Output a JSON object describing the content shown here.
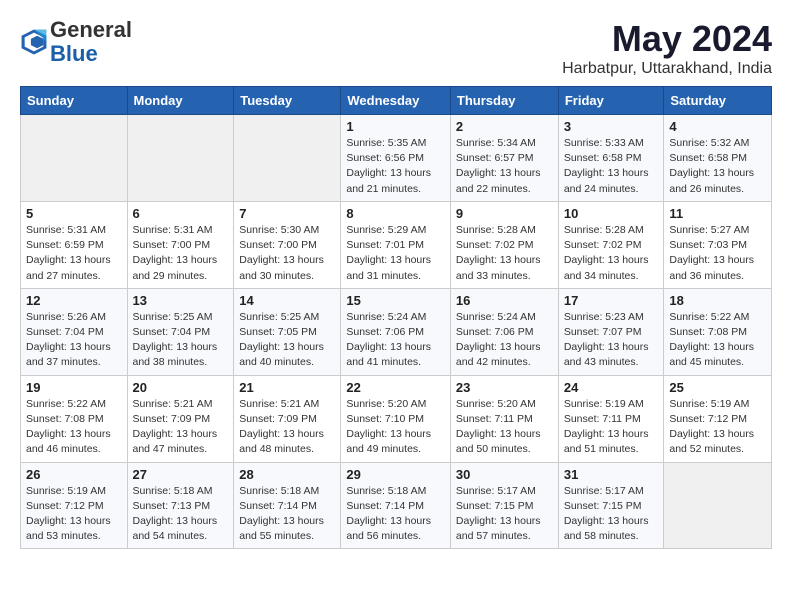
{
  "logo": {
    "general": "General",
    "blue": "Blue"
  },
  "title": "May 2024",
  "subtitle": "Harbatpur, Uttarakhand, India",
  "headers": [
    "Sunday",
    "Monday",
    "Tuesday",
    "Wednesday",
    "Thursday",
    "Friday",
    "Saturday"
  ],
  "weeks": [
    [
      {
        "day": "",
        "info": ""
      },
      {
        "day": "",
        "info": ""
      },
      {
        "day": "",
        "info": ""
      },
      {
        "day": "1",
        "info": "Sunrise: 5:35 AM\nSunset: 6:56 PM\nDaylight: 13 hours\nand 21 minutes."
      },
      {
        "day": "2",
        "info": "Sunrise: 5:34 AM\nSunset: 6:57 PM\nDaylight: 13 hours\nand 22 minutes."
      },
      {
        "day": "3",
        "info": "Sunrise: 5:33 AM\nSunset: 6:58 PM\nDaylight: 13 hours\nand 24 minutes."
      },
      {
        "day": "4",
        "info": "Sunrise: 5:32 AM\nSunset: 6:58 PM\nDaylight: 13 hours\nand 26 minutes."
      }
    ],
    [
      {
        "day": "5",
        "info": "Sunrise: 5:31 AM\nSunset: 6:59 PM\nDaylight: 13 hours\nand 27 minutes."
      },
      {
        "day": "6",
        "info": "Sunrise: 5:31 AM\nSunset: 7:00 PM\nDaylight: 13 hours\nand 29 minutes."
      },
      {
        "day": "7",
        "info": "Sunrise: 5:30 AM\nSunset: 7:00 PM\nDaylight: 13 hours\nand 30 minutes."
      },
      {
        "day": "8",
        "info": "Sunrise: 5:29 AM\nSunset: 7:01 PM\nDaylight: 13 hours\nand 31 minutes."
      },
      {
        "day": "9",
        "info": "Sunrise: 5:28 AM\nSunset: 7:02 PM\nDaylight: 13 hours\nand 33 minutes."
      },
      {
        "day": "10",
        "info": "Sunrise: 5:28 AM\nSunset: 7:02 PM\nDaylight: 13 hours\nand 34 minutes."
      },
      {
        "day": "11",
        "info": "Sunrise: 5:27 AM\nSunset: 7:03 PM\nDaylight: 13 hours\nand 36 minutes."
      }
    ],
    [
      {
        "day": "12",
        "info": "Sunrise: 5:26 AM\nSunset: 7:04 PM\nDaylight: 13 hours\nand 37 minutes."
      },
      {
        "day": "13",
        "info": "Sunrise: 5:25 AM\nSunset: 7:04 PM\nDaylight: 13 hours\nand 38 minutes."
      },
      {
        "day": "14",
        "info": "Sunrise: 5:25 AM\nSunset: 7:05 PM\nDaylight: 13 hours\nand 40 minutes."
      },
      {
        "day": "15",
        "info": "Sunrise: 5:24 AM\nSunset: 7:06 PM\nDaylight: 13 hours\nand 41 minutes."
      },
      {
        "day": "16",
        "info": "Sunrise: 5:24 AM\nSunset: 7:06 PM\nDaylight: 13 hours\nand 42 minutes."
      },
      {
        "day": "17",
        "info": "Sunrise: 5:23 AM\nSunset: 7:07 PM\nDaylight: 13 hours\nand 43 minutes."
      },
      {
        "day": "18",
        "info": "Sunrise: 5:22 AM\nSunset: 7:08 PM\nDaylight: 13 hours\nand 45 minutes."
      }
    ],
    [
      {
        "day": "19",
        "info": "Sunrise: 5:22 AM\nSunset: 7:08 PM\nDaylight: 13 hours\nand 46 minutes."
      },
      {
        "day": "20",
        "info": "Sunrise: 5:21 AM\nSunset: 7:09 PM\nDaylight: 13 hours\nand 47 minutes."
      },
      {
        "day": "21",
        "info": "Sunrise: 5:21 AM\nSunset: 7:09 PM\nDaylight: 13 hours\nand 48 minutes."
      },
      {
        "day": "22",
        "info": "Sunrise: 5:20 AM\nSunset: 7:10 PM\nDaylight: 13 hours\nand 49 minutes."
      },
      {
        "day": "23",
        "info": "Sunrise: 5:20 AM\nSunset: 7:11 PM\nDaylight: 13 hours\nand 50 minutes."
      },
      {
        "day": "24",
        "info": "Sunrise: 5:19 AM\nSunset: 7:11 PM\nDaylight: 13 hours\nand 51 minutes."
      },
      {
        "day": "25",
        "info": "Sunrise: 5:19 AM\nSunset: 7:12 PM\nDaylight: 13 hours\nand 52 minutes."
      }
    ],
    [
      {
        "day": "26",
        "info": "Sunrise: 5:19 AM\nSunset: 7:12 PM\nDaylight: 13 hours\nand 53 minutes."
      },
      {
        "day": "27",
        "info": "Sunrise: 5:18 AM\nSunset: 7:13 PM\nDaylight: 13 hours\nand 54 minutes."
      },
      {
        "day": "28",
        "info": "Sunrise: 5:18 AM\nSunset: 7:14 PM\nDaylight: 13 hours\nand 55 minutes."
      },
      {
        "day": "29",
        "info": "Sunrise: 5:18 AM\nSunset: 7:14 PM\nDaylight: 13 hours\nand 56 minutes."
      },
      {
        "day": "30",
        "info": "Sunrise: 5:17 AM\nSunset: 7:15 PM\nDaylight: 13 hours\nand 57 minutes."
      },
      {
        "day": "31",
        "info": "Sunrise: 5:17 AM\nSunset: 7:15 PM\nDaylight: 13 hours\nand 58 minutes."
      },
      {
        "day": "",
        "info": ""
      }
    ]
  ]
}
